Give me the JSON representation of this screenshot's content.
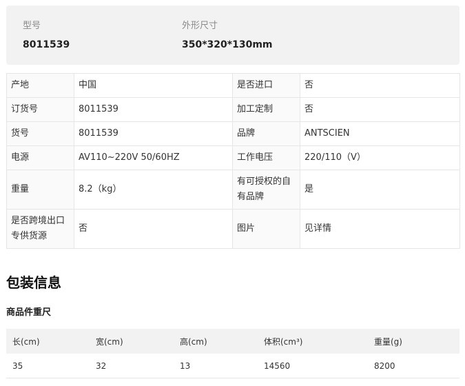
{
  "summary": {
    "model_label": "型号",
    "model_value": "8011539",
    "size_label": "外形尺寸",
    "size_value": "350*320*130mm"
  },
  "specs": [
    [
      {
        "k": "产地",
        "v": "中国"
      },
      {
        "k": "是否进口",
        "v": "否"
      }
    ],
    [
      {
        "k": "订货号",
        "v": "8011539"
      },
      {
        "k": "加工定制",
        "v": "否"
      }
    ],
    [
      {
        "k": "货号",
        "v": "8011539"
      },
      {
        "k": "品牌",
        "v": "ANTSCIEN"
      }
    ],
    [
      {
        "k": "电源",
        "v": "AV110~220V 50/60HZ"
      },
      {
        "k": "工作电压",
        "v": "220/110（V）"
      }
    ],
    [
      {
        "k": "重量",
        "v": "8.2（kg）"
      },
      {
        "k": "有可授权的自有品牌",
        "v": "是"
      }
    ],
    [
      {
        "k": "是否跨境出口专供货源",
        "v": "否"
      },
      {
        "k": "图片",
        "v": "见详情"
      }
    ]
  ],
  "packaging": {
    "title": "包装信息",
    "subtitle": "商品件重尺",
    "columns": [
      "长(cm)",
      "宽(cm)",
      "高(cm)",
      "体积(cm³)",
      "重量(g)"
    ],
    "rows": [
      [
        "35",
        "32",
        "13",
        "14560",
        "8200"
      ]
    ]
  }
}
